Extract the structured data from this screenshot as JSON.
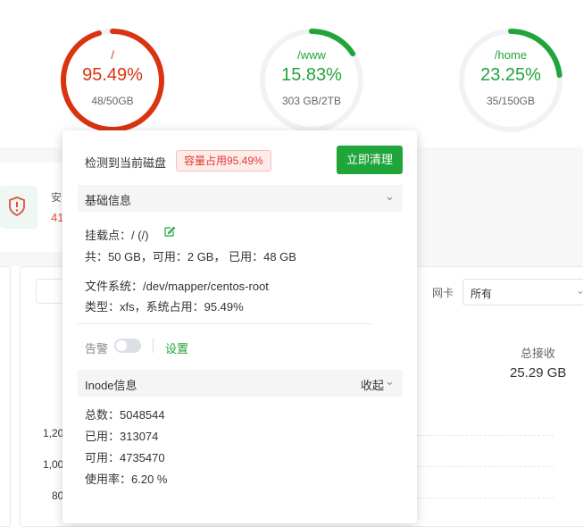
{
  "disks": [
    {
      "mount": "/",
      "percent": "95.49%",
      "size": "48/50GB",
      "fill": 0.9549,
      "color": "#d9330f"
    },
    {
      "mount": "/www",
      "percent": "15.83%",
      "size": "303 GB/2TB",
      "fill": 0.1583,
      "color": "#20a53a"
    },
    {
      "mount": "/home",
      "percent": "23.25%",
      "size": "35/150GB",
      "fill": 0.2325,
      "color": "#20a53a"
    }
  ],
  "background": {
    "security_label": "安",
    "security_value": "41",
    "network_card_label": "网卡",
    "network_card_value": "所有",
    "total_received_label": "总接收",
    "total_received_value": "25.29 GB",
    "yaxis": [
      "1,20",
      "1,00",
      "80"
    ]
  },
  "popup": {
    "detected_text": "检测到当前磁盘",
    "usage_badge": "容量占用95.49%",
    "clean_button": "立即清理",
    "basic_info": {
      "title": "基础信息",
      "mount_point": "挂载点：/ (/)",
      "capacity": "共：50 GB，可用：2 GB， 已用：48 GB",
      "filesystem": "文件系统：/dev/mapper/centos-root",
      "type": "类型：xfs，系统占用：95.49%"
    },
    "alert": {
      "label": "告警",
      "settings": "设置"
    },
    "inode": {
      "title": "Inode信息",
      "collapse": "收起",
      "total": "总数：5048544",
      "used": "已用：313074",
      "available": "可用：4735470",
      "usage": "使用率：6.20 %"
    }
  },
  "colors": {
    "accent_green": "#20a53a",
    "danger_red": "#d9330f",
    "badge_bg": "#fdecea",
    "badge_text": "#e23b2e"
  }
}
